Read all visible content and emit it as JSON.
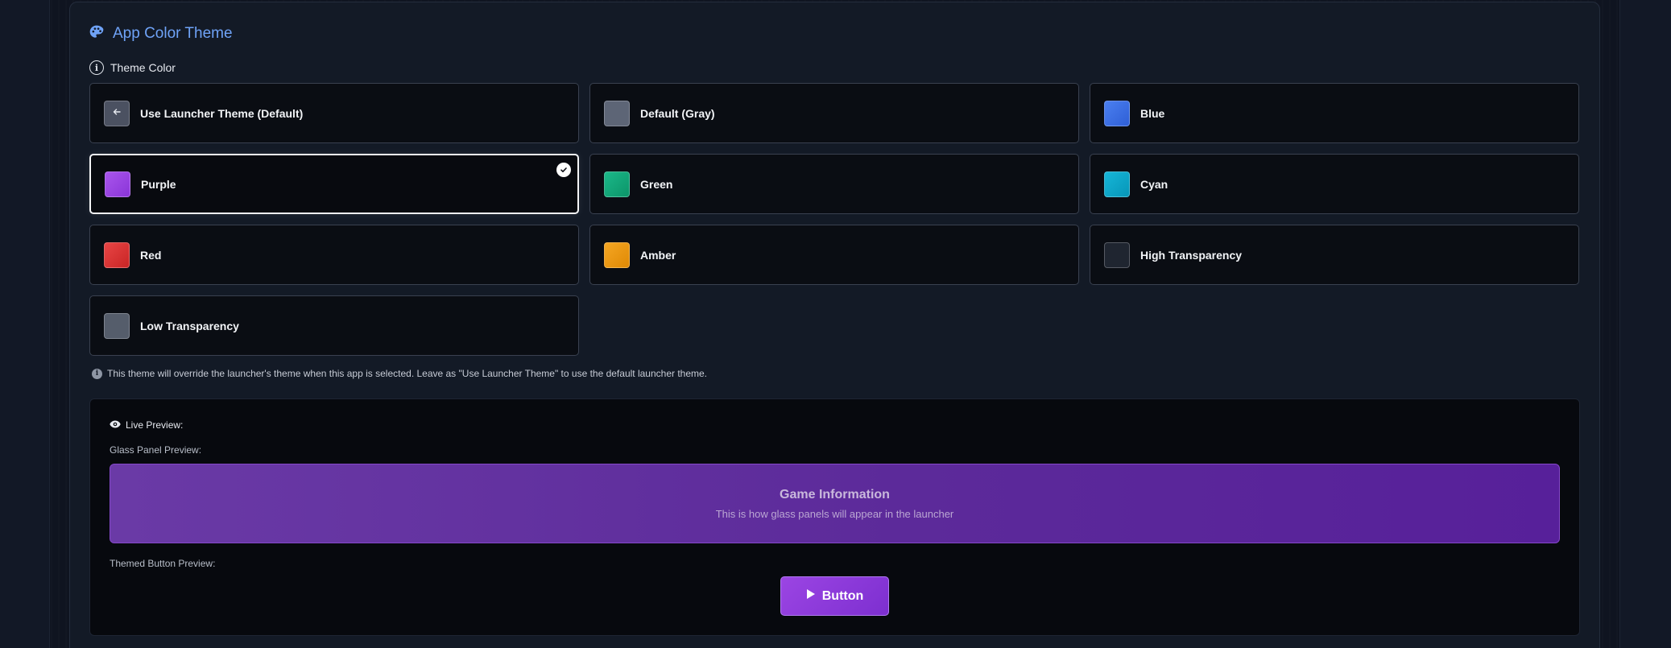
{
  "header": {
    "title": "App Color Theme",
    "icon": "palette-icon",
    "accent": "#6fa3f7"
  },
  "theme_color": {
    "label": "Theme Color",
    "selected": "Purple",
    "options": [
      {
        "label": "Use Launcher Theme (Default)",
        "color": "#4b5161",
        "icon": "arrow-left-icon"
      },
      {
        "label": "Default (Gray)",
        "color": "#5d6576"
      },
      {
        "label": "Blue",
        "color": "#3a6fe0"
      },
      {
        "label": "Purple",
        "color": "#9b45e3"
      },
      {
        "label": "Green",
        "color": "#12a57a"
      },
      {
        "label": "Cyan",
        "color": "#0aa7c9"
      },
      {
        "label": "Red",
        "color": "#dc3535"
      },
      {
        "label": "Amber",
        "color": "#ef9a0d"
      },
      {
        "label": "High Transparency",
        "color": "#1f2530"
      },
      {
        "label": "Low Transparency",
        "color": "#555d6b"
      }
    ]
  },
  "note": "This theme will override the launcher's theme when this app is selected. Leave as \"Use Launcher Theme\" to use the default launcher theme.",
  "preview": {
    "live_label": "Live Preview:",
    "glass_label": "Glass Panel Preview:",
    "glass_title": "Game Information",
    "glass_subtitle": "This is how glass panels will appear in the launcher",
    "button_label": "Themed Button Preview:",
    "button_text": "Button"
  }
}
